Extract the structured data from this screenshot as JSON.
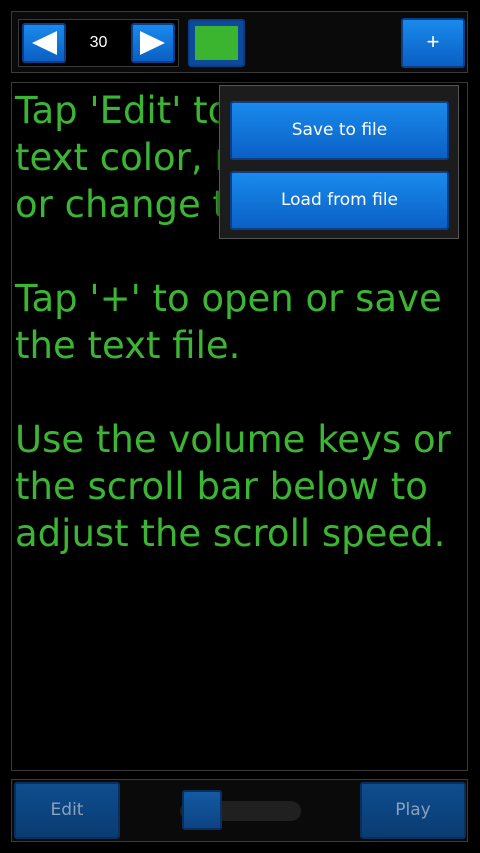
{
  "toolbar": {
    "decrease_icon": "left-triangle-icon",
    "increase_icon": "right-triangle-icon",
    "font_size_value": "30",
    "text_color": "#3bb52f",
    "plus_label": "+"
  },
  "content": {
    "text": "Tap 'Edit' to change the\ntext color, resize text,\nor change the text.\n\nTap '+' to open or save\nthe text file.\n\nUse the volume keys or\nthe scroll bar below to\nadjust the scroll speed.",
    "text_color": "#3cb534"
  },
  "popup_menu": {
    "save_label": "Save to file",
    "load_label": "Load from file"
  },
  "bottom_bar": {
    "edit_label": "Edit",
    "play_label": "Play",
    "scroll_speed_level": 0.05
  },
  "colors": {
    "accent_blue": "#1a8aec",
    "text_green": "#3cb534",
    "background": "#000000"
  }
}
